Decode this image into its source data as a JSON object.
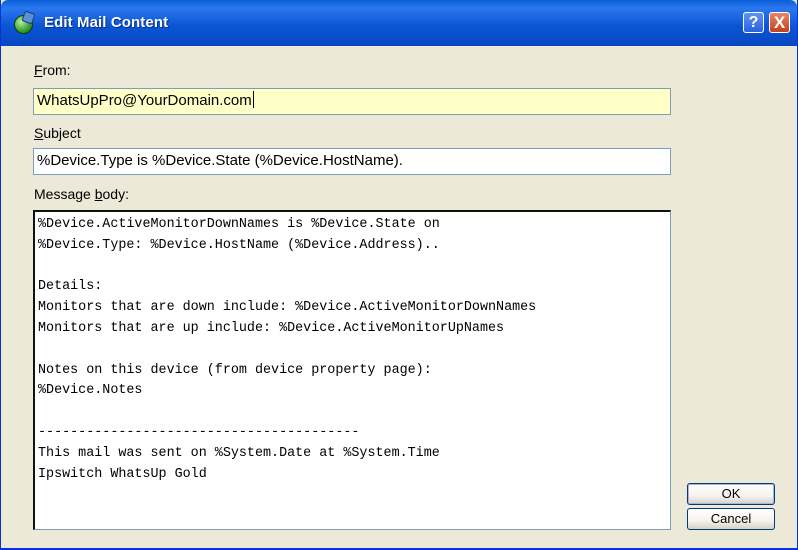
{
  "window": {
    "title": "Edit Mail Content",
    "help_glyph": "?",
    "close_glyph": "X"
  },
  "from": {
    "label_accel": "F",
    "label_rest": "rom:",
    "value": "WhatsUpPro@YourDomain.com"
  },
  "subject": {
    "label_accel": "S",
    "label_rest": "ubject",
    "value": "%Device.Type is %Device.State (%Device.HostName)."
  },
  "message_body": {
    "label_pre": "Message ",
    "label_accel": "b",
    "label_post": "ody:",
    "lines": [
      "%Device.ActiveMonitorDownNames is %Device.State on",
      "%Device.Type: %Device.HostName (%Device.Address)..",
      "",
      "Details:",
      "Monitors that are down include: %Device.ActiveMonitorDownNames",
      "Monitors that are up include: %Device.ActiveMonitorUpNames",
      "",
      "Notes on this device (from device property page):",
      "%Device.Notes",
      "",
      "----------------------------------------",
      "This mail was sent on %System.Date at %System.Time",
      "Ipswitch WhatsUp Gold"
    ]
  },
  "buttons": {
    "ok": "OK",
    "cancel": "Cancel"
  },
  "icons": {
    "app": "network-globe-icon",
    "help": "help-icon",
    "close": "close-icon"
  }
}
